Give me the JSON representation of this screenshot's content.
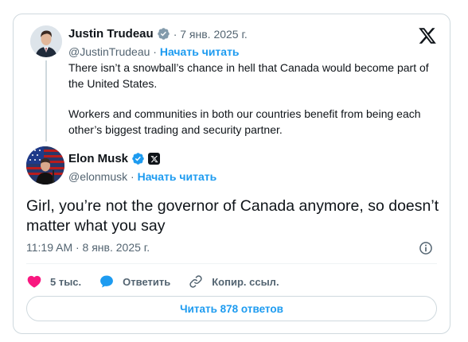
{
  "quoted_tweet": {
    "author_name": "Justin Trudeau",
    "date": "· 7 янв. 2025 г.",
    "handle": "@JustinTrudeau",
    "separator": " · ",
    "follow_label": "Начать читать",
    "paragraphs": [
      "There isn’t a snowball’s chance in hell that Canada would become part of the United States.",
      "Workers and communities in both our countries benefit from being each other’s biggest trading and security partner."
    ]
  },
  "main_tweet": {
    "author_name": "Elon Musk",
    "handle": "@elonmusk",
    "separator": " · ",
    "follow_label": "Начать читать",
    "text": "Girl, you’re not the governor of Canada anymore, so doesn’t matter what you say",
    "timestamp": "11:19 AM · 8 янв. 2025 г."
  },
  "actions": {
    "like_count": "5 тыс.",
    "reply_label": "Ответить",
    "copy_link_label": "Копир. ссыл."
  },
  "read_replies_label": "Читать 878 ответов",
  "colors": {
    "accent": "#1d9bf0",
    "like": "#f91880",
    "secondary_text": "#536471",
    "border": "#cfd9de"
  }
}
